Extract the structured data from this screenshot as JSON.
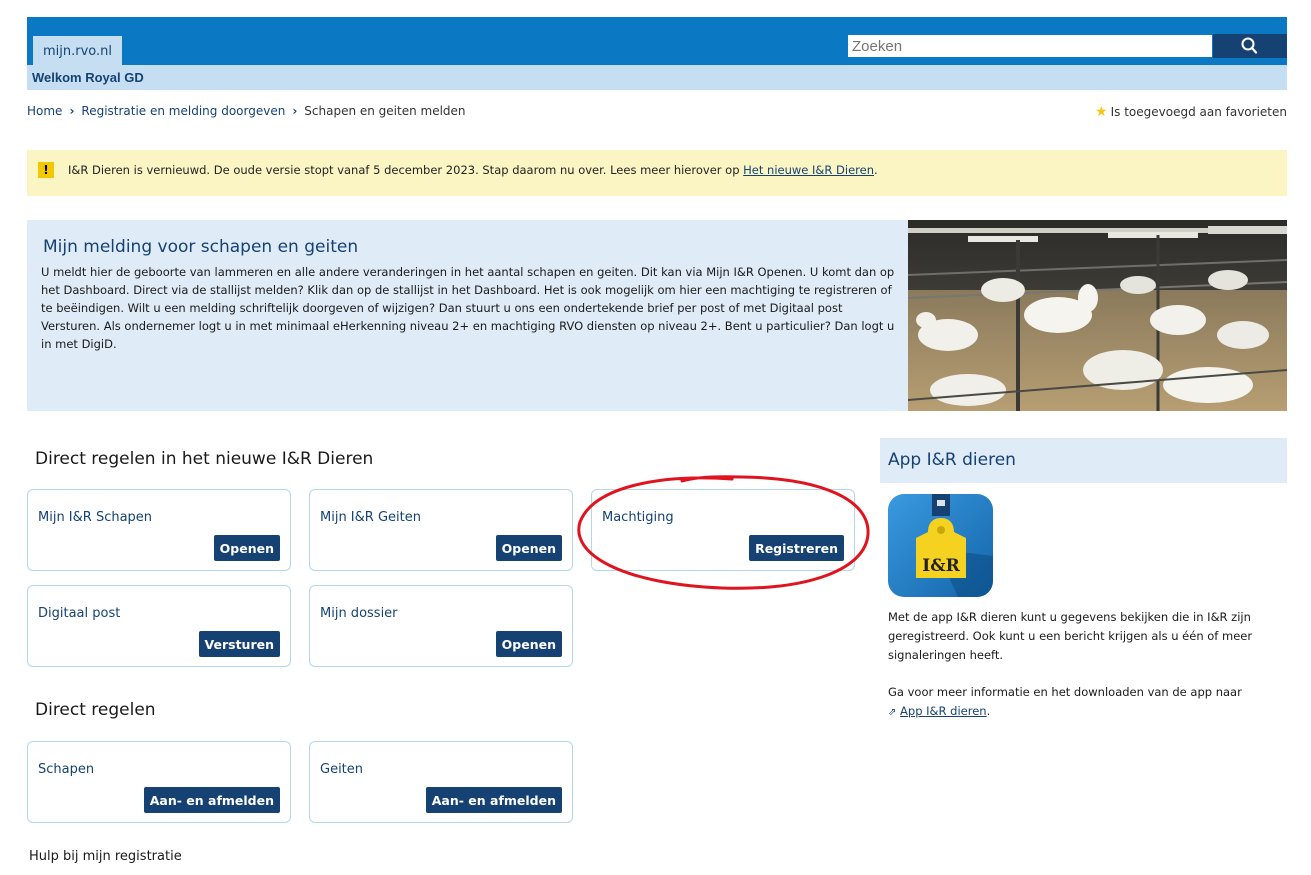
{
  "header": {
    "site_tab": "mijn.rvo.nl",
    "search_placeholder": "Zoeken",
    "welcome": "Welkom Royal GD",
    "search_icon": "magnifier-icon"
  },
  "breadcrumb": {
    "items": [
      "Home",
      "Registratie en melding doorgeven",
      "Schapen en geiten melden"
    ]
  },
  "favorites": {
    "label": "Is toegevoegd aan favorieten",
    "icon": "star-icon"
  },
  "notice": {
    "text": "I&R Dieren is vernieuwd. De oude versie stopt vanaf 5 december 2023. Stap daarom nu over. Lees meer hierover op ",
    "link": "Het nieuwe I&R Dieren",
    "suffix": ".",
    "icon_glyph": "!"
  },
  "intro": {
    "title": "Mijn melding voor schapen en geiten",
    "text": "U meldt hier de geboorte van lammeren en alle andere veranderingen in het aantal schapen en geiten. Dit kan via Mijn I&R Openen. U komt dan op het Dashboard. Direct via de stallijst melden? Klik dan op de stallijst in het Dashboard. Het is ook mogelijk om hier een machtiging te registreren of te beëindigen. Wilt u een melding schriftelijk doorgeven of wijzigen? Dan stuurt u ons een ondertekende brief per post of met Digitaal post Versturen. Als ondernemer logt u in met minimaal eHerkenning niveau 2+ en machtiging RVO diensten op niveau 2+. Bent u particulier? Dan logt u in met DigiD."
  },
  "new_section": {
    "title": "Direct regelen in het nieuwe I&R Dieren",
    "cards": [
      {
        "label": "Mijn I&R Schapen",
        "button": "Openen"
      },
      {
        "label": "Mijn I&R Geiten",
        "button": "Openen"
      },
      {
        "label": "Machtiging",
        "button": "Registreren"
      },
      {
        "label": "Digitaal post",
        "button": "Versturen"
      },
      {
        "label": "Mijn dossier",
        "button": "Openen"
      }
    ]
  },
  "direct_section": {
    "title": "Direct regelen",
    "cards": [
      {
        "label": "Schapen",
        "button": "Aan- en afmelden"
      },
      {
        "label": "Geiten",
        "button": "Aan- en afmelden"
      }
    ]
  },
  "app": {
    "title": "App I&R dieren",
    "icon_text": "I&R",
    "description": "Met de app I&R dieren kunt u gegevens bekijken die in I&R zijn geregistreerd. Ook kunt u een bericht krijgen als u één of meer signaleringen heeft.",
    "more_text": "Ga voor meer informatie en het downloaden van de app naar ",
    "link": "App I&R dieren",
    "link_suffix": "."
  },
  "help": {
    "label": "Hulp bij mijn registratie"
  },
  "colors": {
    "primary_blue": "#0b78c4",
    "dark_blue": "#154273",
    "light_blue": "#c5def2",
    "panel_blue": "#dfebf6",
    "notice_yellow": "#fbf5c4",
    "annotation_red": "#e0141e"
  }
}
